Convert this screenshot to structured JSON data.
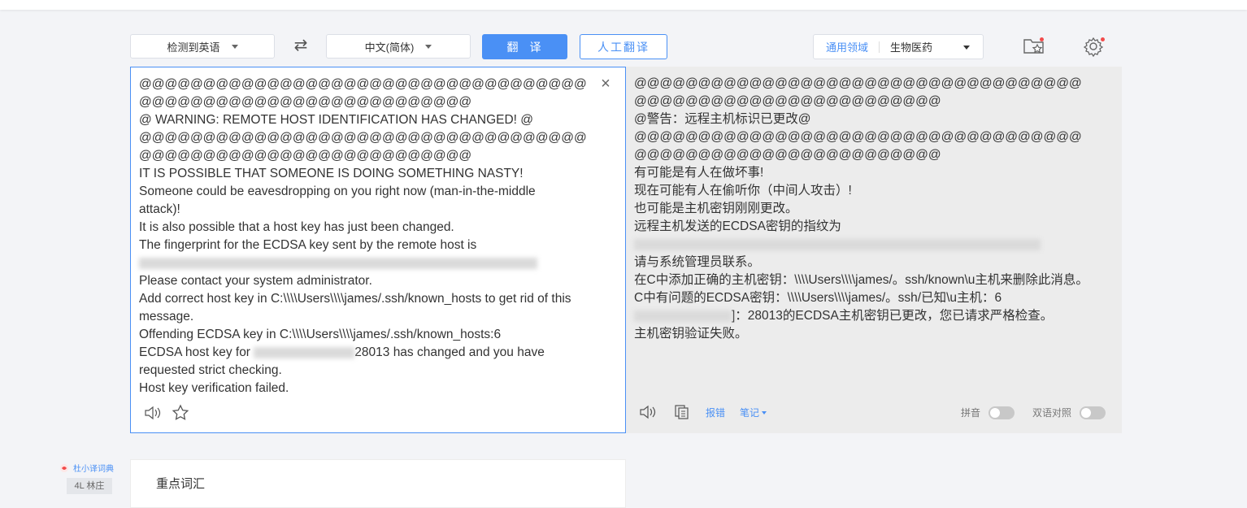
{
  "toolbar": {
    "source_lang": "检测到英语",
    "target_lang": "中文(简体)",
    "swap_icon": "⇄",
    "translate_label": "翻译",
    "human_translate_label": "人工翻译",
    "domain_general": "通用领域",
    "domain_value": "生物医药"
  },
  "source": {
    "lines": [
      "@@@@@@@@@@@@@@@@@@@@@@@@@@@@@@@@@@@",
      "@@@@@@@@@@@@@@@@@@@@@@@@@@",
      "@    WARNING: REMOTE HOST IDENTIFICATION HAS CHANGED!     @",
      "@@@@@@@@@@@@@@@@@@@@@@@@@@@@@@@@@@@",
      "@@@@@@@@@@@@@@@@@@@@@@@@@@",
      "IT IS POSSIBLE THAT SOMEONE IS DOING SOMETHING NASTY!",
      "Someone could be eavesdropping on you right now (man-in-the-middle",
      "attack)!",
      "It is also possible that a host key has just been changed.",
      "The fingerprint for the ECDSA key sent by the remote host is",
      "",
      "Please contact your system administrator.",
      "Add correct host key in C:\\\\\\\\Users\\\\\\\\james/.ssh/known_hosts to get rid of this",
      "message.",
      "Offending ECDSA key in C:\\\\\\\\Users\\\\\\\\james/.ssh/known_hosts:6",
      "28013 has changed and you have",
      "requested strict checking.",
      "Host key verification failed."
    ],
    "line15_prefix": "ECDSA host key for "
  },
  "target": {
    "lines": [
      "@@@@@@@@@@@@@@@@@@@@@@@@@@@@@@@@@@@",
      "@@@@@@@@@@@@@@@@@@@@@@@@",
      "@警告：远程主机标识已更改@",
      "@@@@@@@@@@@@@@@@@@@@@@@@@@@@@@@@@@@",
      "@@@@@@@@@@@@@@@@@@@@@@@@",
      "有可能是有人在做坏事!",
      "现在可能有人在偷听你（中间人攻击）!",
      "也可能是主机密钥刚刚更改。",
      "远程主机发送的ECDSA密钥的指纹为",
      "",
      "请与系统管理员联系。",
      "在C中添加正确的主机密钥：\\\\\\\\Users\\\\\\\\james/。ssh/known\\u主机来删除此消息。",
      "C中有问题的ECDSA密钥：\\\\\\\\Users\\\\\\\\james/。ssh/已知\\u主机：6",
      "]：28013的ECDSA主机密钥已更改，您已请求严格检查。",
      "主机密钥验证失败。"
    ]
  },
  "target_footer": {
    "report_label": "报错",
    "notes_label": "笔记",
    "pinyin_label": "拼音",
    "bilingual_label": "双语对照"
  },
  "bottom": {
    "dict_label": "杜小译词典",
    "side_tab": "4L 林庄",
    "vocab_title": "重点词汇"
  },
  "colors": {
    "accent": "#4a90f5",
    "target_bg": "#ececec",
    "notification_dot": "#f24b4b"
  }
}
